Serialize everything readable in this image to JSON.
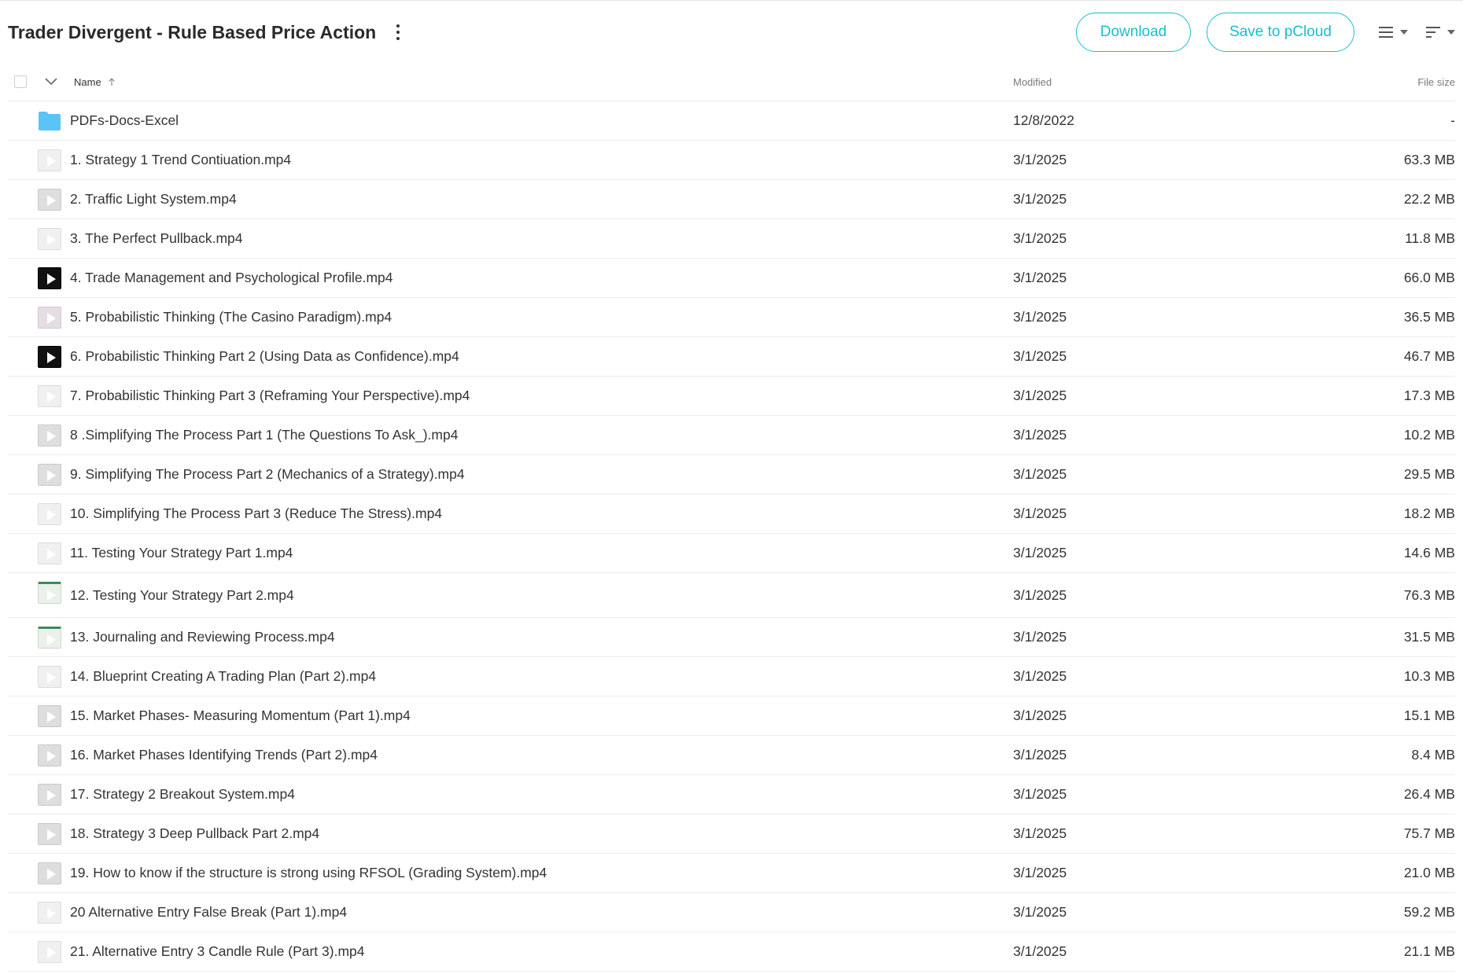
{
  "header": {
    "title": "Trader Divergent - Rule Based Price Action",
    "download_label": "Download",
    "save_label": "Save to pCloud"
  },
  "columns": {
    "name": "Name",
    "modified": "Modified",
    "size": "File size"
  },
  "colors": {
    "accent": "#17bed0",
    "folder": "#5bc3f5"
  },
  "rows": [
    {
      "name": "PDFs-Docs-Excel",
      "modified": "12/8/2022",
      "size": "-",
      "icon": "folder-icon"
    },
    {
      "name": "1. Strategy 1 Trend Contiuation.mp4",
      "modified": "3/1/2025",
      "size": "63.3 MB",
      "icon": "video-icon"
    },
    {
      "name": "2. Traffic Light System.mp4",
      "modified": "3/1/2025",
      "size": "22.2 MB",
      "icon": "video-icon"
    },
    {
      "name": "3. The Perfect Pullback.mp4",
      "modified": "3/1/2025",
      "size": "11.8 MB",
      "icon": "video-icon"
    },
    {
      "name": "4. Trade Management and Psychological Profile.mp4",
      "modified": "3/1/2025",
      "size": "66.0 MB",
      "icon": "video-icon"
    },
    {
      "name": "5. Probabilistic Thinking (The Casino Paradigm).mp4",
      "modified": "3/1/2025",
      "size": "36.5 MB",
      "icon": "video-icon"
    },
    {
      "name": "6. Probabilistic Thinking Part 2 (Using Data as Confidence).mp4",
      "modified": "3/1/2025",
      "size": "46.7 MB",
      "icon": "video-icon"
    },
    {
      "name": "7. Probabilistic Thinking Part 3 (Reframing Your Perspective).mp4",
      "modified": "3/1/2025",
      "size": "17.3 MB",
      "icon": "video-icon"
    },
    {
      "name": "8 .Simplifying The Process Part 1 (The Questions To Ask_).mp4",
      "modified": "3/1/2025",
      "size": "10.2 MB",
      "icon": "video-icon"
    },
    {
      "name": "9. Simplifying The Process Part 2 (Mechanics of a Strategy).mp4",
      "modified": "3/1/2025",
      "size": "29.5 MB",
      "icon": "video-icon"
    },
    {
      "name": "10. Simplifying The Process Part 3 (Reduce The Stress).mp4",
      "modified": "3/1/2025",
      "size": "18.2 MB",
      "icon": "video-icon"
    },
    {
      "name": "11. Testing Your Strategy Part 1.mp4",
      "modified": "3/1/2025",
      "size": "14.6 MB",
      "icon": "video-icon"
    },
    {
      "name": "12. Testing Your Strategy Part 2.mp4",
      "modified": "3/1/2025",
      "size": "76.3 MB",
      "icon": "video-icon"
    },
    {
      "name": "13. Journaling and Reviewing Process.mp4",
      "modified": "3/1/2025",
      "size": "31.5 MB",
      "icon": "video-icon"
    },
    {
      "name": "14. Blueprint Creating A Trading Plan (Part 2).mp4",
      "modified": "3/1/2025",
      "size": "10.3 MB",
      "icon": "video-icon"
    },
    {
      "name": "15. Market Phases- Measuring Momentum (Part 1).mp4",
      "modified": "3/1/2025",
      "size": "15.1 MB",
      "icon": "video-icon"
    },
    {
      "name": "16. Market Phases Identifying Trends (Part 2).mp4",
      "modified": "3/1/2025",
      "size": "8.4 MB",
      "icon": "video-icon"
    },
    {
      "name": "17. Strategy 2 Breakout System.mp4",
      "modified": "3/1/2025",
      "size": "26.4 MB",
      "icon": "video-icon"
    },
    {
      "name": "18. Strategy 3 Deep Pullback Part 2.mp4",
      "modified": "3/1/2025",
      "size": "75.7 MB",
      "icon": "video-icon"
    },
    {
      "name": "19. How to know if the structure is strong using RFSOL (Grading System).mp4",
      "modified": "3/1/2025",
      "size": "21.0 MB",
      "icon": "video-icon"
    },
    {
      "name": "20 Alternative Entry False Break (Part 1).mp4",
      "modified": "3/1/2025",
      "size": "59.2 MB",
      "icon": "video-icon"
    },
    {
      "name": "21. Alternative Entry 3 Candle Rule (Part 3).mp4",
      "modified": "3/1/2025",
      "size": "21.1 MB",
      "icon": "video-icon"
    }
  ]
}
